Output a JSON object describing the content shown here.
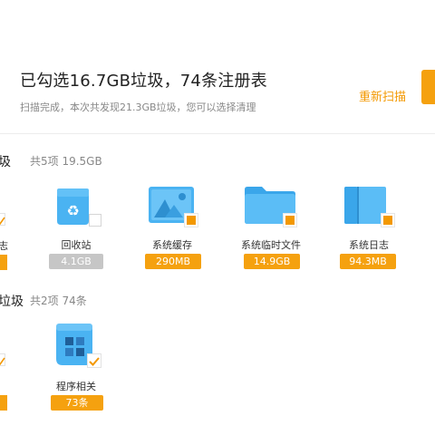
{
  "summary": {
    "title": "已勾选16.7GB垃圾，74条注册表",
    "subtitle": "扫描完成，本次共发现21.3GB垃圾，您可以选择清理",
    "rescan_label": "重新扫描"
  },
  "sections": [
    {
      "title_fragment": "圾",
      "meta": "共5项 19.5GB",
      "stub_label": "志",
      "items": [
        {
          "label": "回收站",
          "size": "4.1GB",
          "icon": "recycle-bin-icon",
          "checked": false,
          "badge_color": "#c6c6c6"
        },
        {
          "label": "系统缓存",
          "size": "290MB",
          "icon": "image-cache-icon",
          "checked": true,
          "badge_color": "#f5a10f"
        },
        {
          "label": "系统临时文件",
          "size": "14.9GB",
          "icon": "folder-icon",
          "checked": true,
          "badge_color": "#f5a10f"
        },
        {
          "label": "系统日志",
          "size": "94.3MB",
          "icon": "log-book-icon",
          "checked": true,
          "badge_color": "#f5a10f"
        }
      ]
    },
    {
      "title_fragment": "垃圾",
      "meta": "共2项 74条",
      "items": [
        {
          "label": "程序相关",
          "size": "73条",
          "icon": "program-registry-icon",
          "checked": true,
          "badge_color": "#f5a10f"
        }
      ]
    }
  ],
  "colors": {
    "accent": "#f39800",
    "icon_blue": "#4ab3f2",
    "badge_grey": "#c6c6c6"
  }
}
